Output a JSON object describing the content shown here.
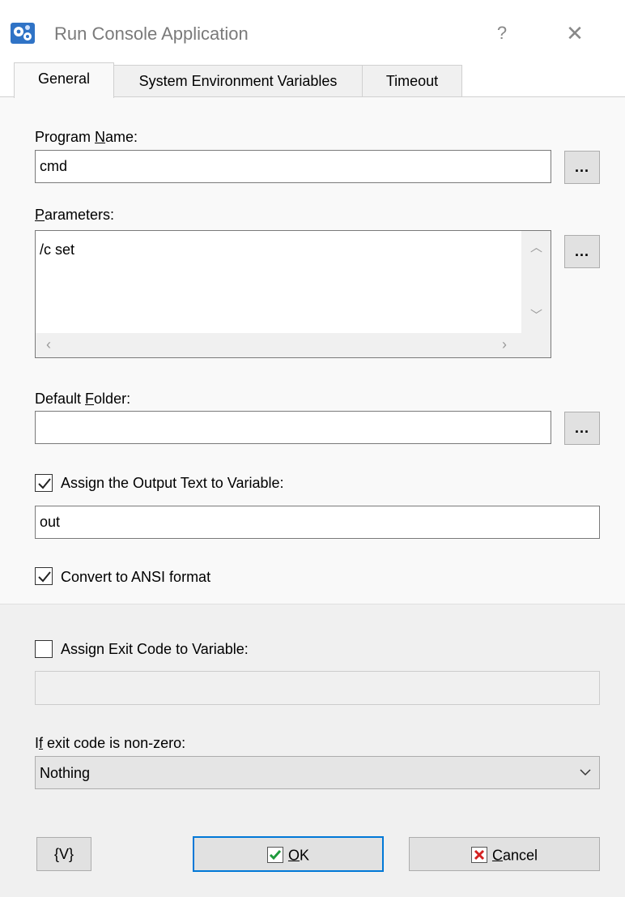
{
  "window": {
    "title": "Run Console Application",
    "help_glyph": "?",
    "close_glyph": "✕",
    "icon": "gears-app-icon"
  },
  "tabs": [
    {
      "label": "General",
      "selected": true
    },
    {
      "label": "System Environment Variables",
      "selected": false
    },
    {
      "label": "Timeout",
      "selected": false
    }
  ],
  "general": {
    "program_name": {
      "label_pre": "Program ",
      "label_key": "N",
      "label_post": "ame:",
      "value": "cmd",
      "browse_label": "..."
    },
    "parameters": {
      "label_key": "P",
      "label_post": "arameters:",
      "value": "/c set",
      "browse_label": "..."
    },
    "default_folder": {
      "label_pre": "Default ",
      "label_key": "F",
      "label_post": "older:",
      "value": "",
      "browse_label": "..."
    },
    "assign_output": {
      "label": "Assign the Output Text to Variable:",
      "checked": true,
      "value": "out"
    },
    "convert_ansi": {
      "label": "Convert to ANSI format",
      "checked": true
    }
  },
  "exit_code": {
    "assign": {
      "label": "Assign Exit Code to Variable:",
      "checked": false,
      "value": ""
    },
    "nonzero": {
      "label_pre": "I",
      "label_key": "f",
      "label_post": " exit code is non-zero:",
      "selected": "Nothing"
    }
  },
  "buttons": {
    "variables": "{V}",
    "ok_key": "O",
    "ok_rest": "K",
    "cancel_key": "C",
    "cancel_rest": "ancel"
  },
  "colors": {
    "accent": "#0078d7",
    "ok_check": "#1e9a3c",
    "cancel_x": "#d42121"
  }
}
